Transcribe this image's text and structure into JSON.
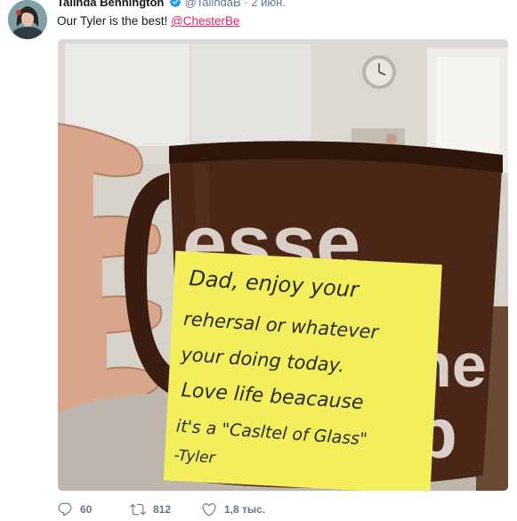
{
  "tweet": {
    "display_name": "Talinda Bennington",
    "handle": "@TalindaB",
    "separator": "·",
    "timestamp": "2 июн.",
    "text": "Our Tyler is the best!",
    "mention": "@ChesterBe"
  },
  "photo": {
    "note_lines": [
      "Dad, enjoy your",
      "rehersal or whatever",
      "your doing today.",
      "Love life beacause",
      "it's a \"Casltel of Glass\"",
      "-Tyler"
    ]
  },
  "actions": {
    "reply": {
      "icon": "reply-icon",
      "count": "60"
    },
    "retweet": {
      "icon": "retweet-icon",
      "count": "812"
    },
    "like": {
      "icon": "heart-icon",
      "count": "1,8 тыс."
    }
  },
  "colors": {
    "mention": "#e0245e",
    "meta": "#657786",
    "verified": "#1da1f2",
    "mug": "#4a2616",
    "note": "#f3ee5b"
  }
}
